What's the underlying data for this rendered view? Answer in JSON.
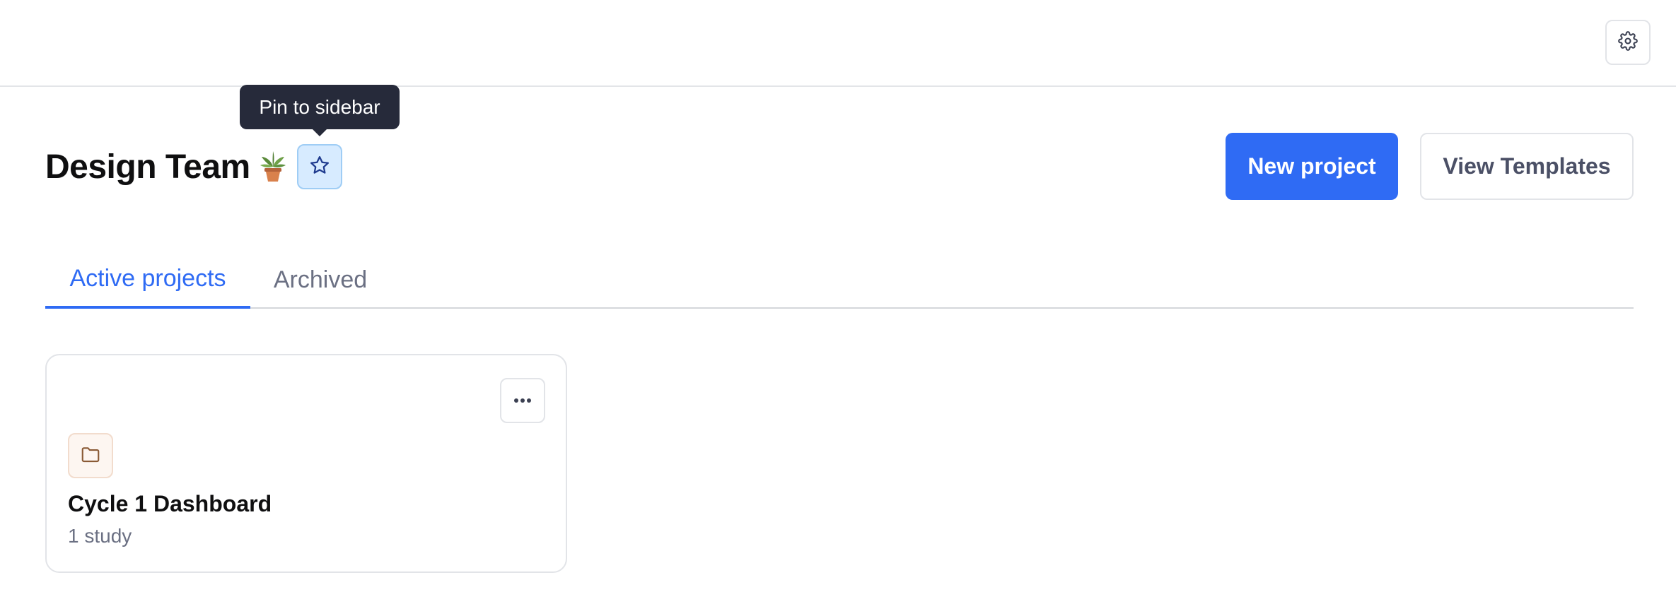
{
  "header": {
    "settings_icon": "gear-icon"
  },
  "page": {
    "title": "Design Team",
    "emoji_icon": "potted-plant-icon",
    "pin_icon": "star-icon",
    "pin_tooltip": "Pin to sidebar"
  },
  "actions": {
    "new_project_label": "New project",
    "view_templates_label": "View Templates"
  },
  "tabs": [
    {
      "label": "Active projects",
      "active": true
    },
    {
      "label": "Archived",
      "active": false
    }
  ],
  "projects": [
    {
      "name": "Cycle 1 Dashboard",
      "meta": "1 study",
      "icon": "folder-icon",
      "menu_icon": "more-horizontal-icon"
    }
  ],
  "colors": {
    "primary": "#2f6bf4",
    "tooltip_bg": "#262a3a",
    "pin_bg": "#d7ebff",
    "muted_text": "#6b7083"
  }
}
